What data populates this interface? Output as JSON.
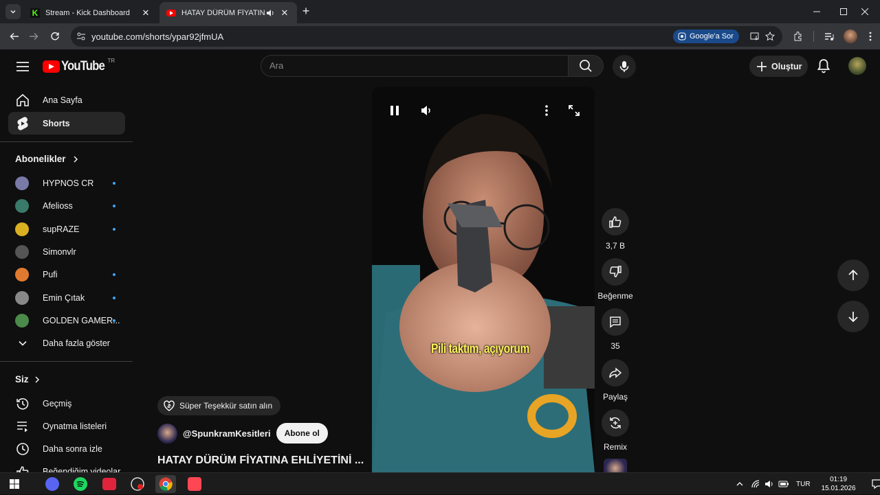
{
  "browser": {
    "tabs": [
      {
        "title": "Stream - Kick Dashboard",
        "favicon": "kick-icon"
      },
      {
        "title": "HATAY DÜRÜM FİYATINA EHLİYETİNİ ...",
        "favicon": "youtube-icon",
        "active": true
      }
    ],
    "url": "youtube.com/shorts/ypar92jfmUA",
    "google_ask": "Google'a Sor"
  },
  "youtube": {
    "logo_text": "YouTube",
    "logo_region": "TR",
    "search_placeholder": "Ara",
    "create_label": "Oluştur",
    "nav": [
      {
        "label": "Ana Sayfa",
        "icon": "home-icon"
      },
      {
        "label": "Shorts",
        "icon": "shorts-icon",
        "active": true
      }
    ],
    "subscriptions_title": "Abonelikler",
    "subscriptions": [
      {
        "name": "HYPNOS CR",
        "new": true,
        "color": "#7a7aa8"
      },
      {
        "name": "Afelioss",
        "new": true,
        "color": "#3a7a6a"
      },
      {
        "name": "supRAZE",
        "new": true,
        "color": "#d8b020"
      },
      {
        "name": "Simonvlr",
        "new": false,
        "color": "#555555"
      },
      {
        "name": "Pufi",
        "new": true,
        "color": "#e07a30"
      },
      {
        "name": "Emin Çıtak",
        "new": true,
        "color": "#888888"
      },
      {
        "name": "GOLDEN GAMER...",
        "new": true,
        "color": "#4a8a4a"
      }
    ],
    "show_more": "Daha fazla göster",
    "you_title": "Siz",
    "you_items": [
      {
        "label": "Geçmiş",
        "icon": "history-icon"
      },
      {
        "label": "Oynatma listeleri",
        "icon": "playlists-icon"
      },
      {
        "label": "Daha sonra izle",
        "icon": "watch-later-icon"
      },
      {
        "label": "Beğendiğim videolar",
        "icon": "like-icon"
      }
    ],
    "short": {
      "caption": "Pili taktım, açıyorum",
      "likes": "3,7 B",
      "dislike_label": "Beğenme",
      "comments": "35",
      "share_label": "Paylaş",
      "remix_label": "Remix",
      "super_thanks": "Süper Teşekkür satın alın",
      "channel": "@SpunkramKesitleri",
      "subscribe_label": "Abone ol",
      "title": "HATAY DÜRÜM FİYATINA EHLİYETİNİ ..."
    }
  },
  "taskbar": {
    "language": "TUR",
    "time": "01:19",
    "date": "15.01.2026"
  }
}
